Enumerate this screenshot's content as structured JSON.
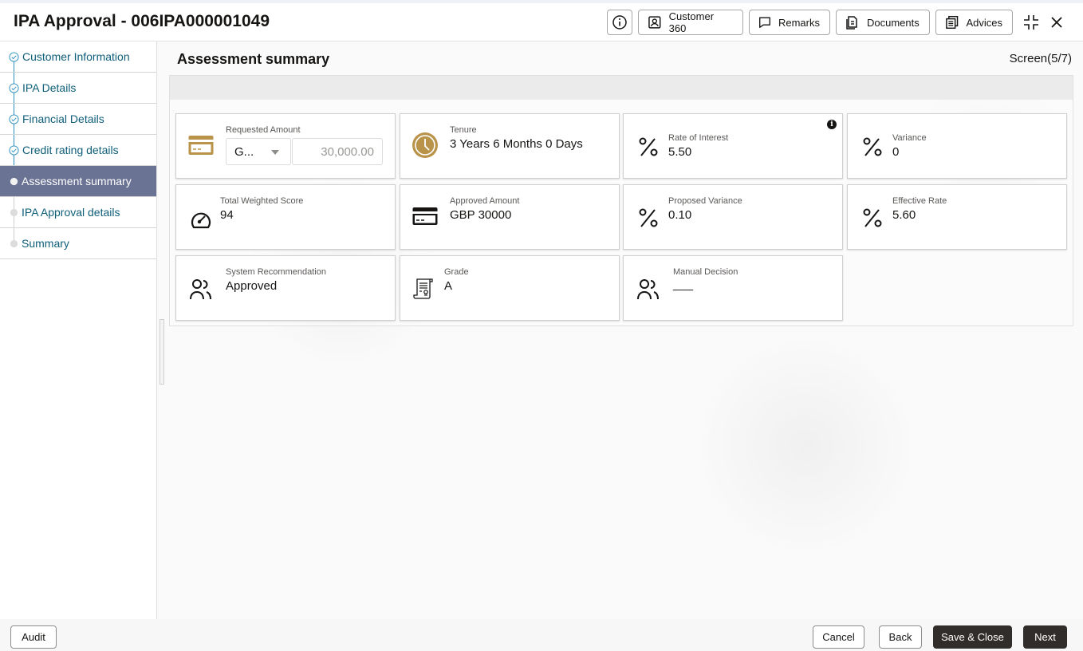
{
  "header": {
    "title": "IPA Approval - 006IPA000001049",
    "buttons": {
      "customer360": "Customer 360",
      "remarks": "Remarks",
      "documents": "Documents",
      "advices": "Advices"
    }
  },
  "sidebar": {
    "items": [
      {
        "label": "Customer Information",
        "state": "completed"
      },
      {
        "label": "IPA Details",
        "state": "completed"
      },
      {
        "label": "Financial Details",
        "state": "completed"
      },
      {
        "label": "Credit rating details",
        "state": "completed"
      },
      {
        "label": "Assessment summary",
        "state": "active"
      },
      {
        "label": "IPA Approval details",
        "state": "pending"
      },
      {
        "label": "Summary",
        "state": "pending"
      }
    ]
  },
  "main": {
    "section_title": "Assessment summary",
    "screen_count": "Screen(5/7)",
    "cards": {
      "requested_amount": {
        "label": "Requested Amount",
        "currency": "G...",
        "value": "30,000.00"
      },
      "tenure": {
        "label": "Tenure",
        "value": "3 Years 6 Months 0 Days"
      },
      "rate_of_interest": {
        "label": "Rate of Interest",
        "value": "5.50"
      },
      "variance": {
        "label": "Variance",
        "value": "0"
      },
      "total_weighted_score": {
        "label": "Total Weighted Score",
        "value": "94"
      },
      "approved_amount": {
        "label": "Approved Amount",
        "value": "GBP 30000"
      },
      "proposed_variance": {
        "label": "Proposed Variance",
        "value": "0.10"
      },
      "effective_rate": {
        "label": "Effective Rate",
        "value": "5.60"
      },
      "system_recommendation": {
        "label": "System Recommendation",
        "value": "Approved"
      },
      "grade": {
        "label": "Grade",
        "value": "A"
      },
      "manual_decision": {
        "label": "Manual Decision",
        "value": "___"
      }
    },
    "info_glyph": "i"
  },
  "footer": {
    "audit": "Audit",
    "cancel": "Cancel",
    "back": "Back",
    "save_close": "Save & Close",
    "next": "Next"
  },
  "colors": {
    "accent_gold": "#b9934a",
    "nav_active": "#6b7395",
    "nav_text": "#0e5e79",
    "primary_button": "#312d2a"
  }
}
